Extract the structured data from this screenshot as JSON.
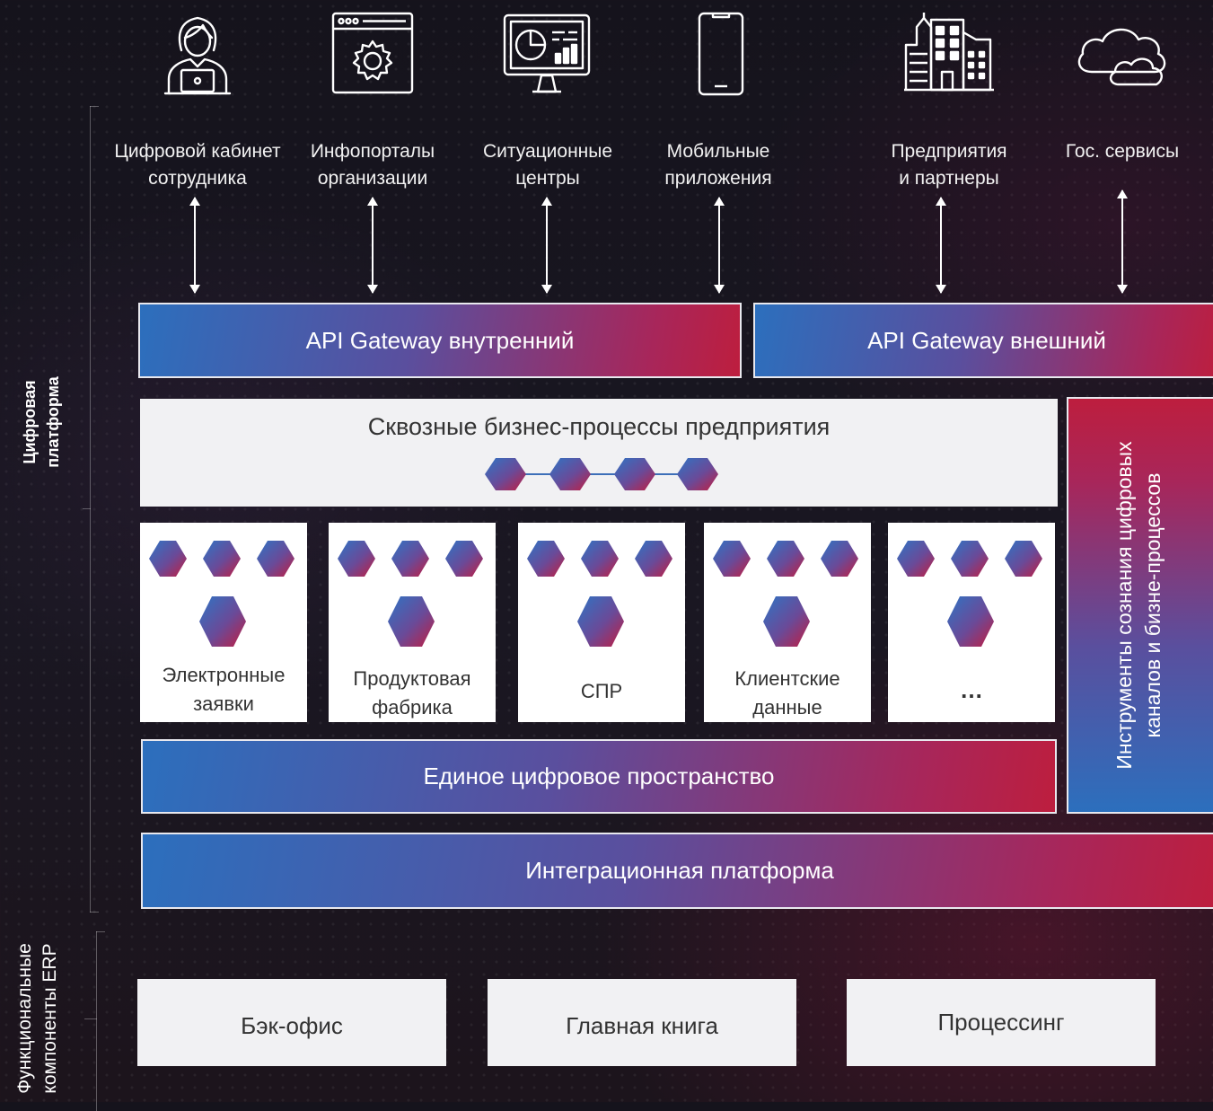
{
  "channels": [
    {
      "icon": "employee-laptop-icon",
      "line1": "Цифровой кабинет",
      "line2": "сотрудника"
    },
    {
      "icon": "browser-gear-icon",
      "line1": "Инфопорталы",
      "line2": "организации"
    },
    {
      "icon": "dashboard-monitor-icon",
      "line1": "Ситуационные",
      "line2": "центры"
    },
    {
      "icon": "smartphone-icon",
      "line1": "Мобильные",
      "line2": "приложения"
    },
    {
      "icon": "buildings-icon",
      "line1": "Предприятия",
      "line2": "и партнеры"
    },
    {
      "icon": "cloud-icon",
      "line1": "Гос. сервисы",
      "line2": ""
    }
  ],
  "gateways": {
    "internal": "API Gateway внутренний",
    "external": "API Gateway внешний"
  },
  "processes": {
    "title": "Сквозные бизнес-процессы предприятия"
  },
  "modules": [
    {
      "line1": "Электронные",
      "line2": "заявки"
    },
    {
      "line1": "Продуктовая",
      "line2": "фабрика"
    },
    {
      "line1": "СПР",
      "line2": ""
    },
    {
      "line1": "Клиентские",
      "line2": "данные"
    },
    {
      "line1": "…",
      "line2": ""
    }
  ],
  "tools": {
    "line1": "Инструменты сознания цифровых",
    "line2": "каналов и бизне-процессов"
  },
  "digital_space": "Единое цифровое пространство",
  "integration_platform": "Интеграционная платформа",
  "side_labels": {
    "digital_platform_line1": "Цифровая",
    "digital_platform_line2": "платформа",
    "erp_line1": "Функциональные",
    "erp_line2": "компоненты ERP"
  },
  "erp_components": [
    "Бэк-офис",
    "Главная книга",
    "Процессинг"
  ],
  "colors": {
    "gradient_start": "#2c6fbd",
    "gradient_end": "#bd1e3e",
    "background": "#17141d"
  }
}
